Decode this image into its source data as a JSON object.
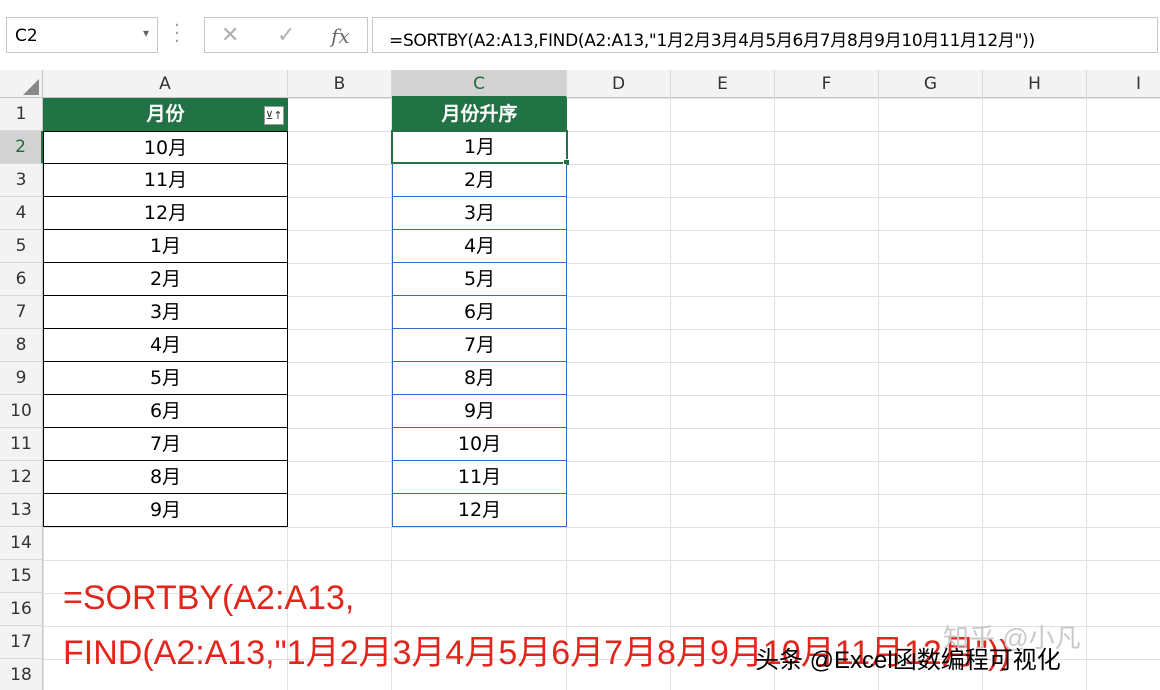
{
  "name_box": {
    "value": "C2",
    "dropdown_glyph": "▾"
  },
  "formula_buttons": {
    "cancel": "✕",
    "enter": "✓",
    "fx": "fx"
  },
  "formula_bar": {
    "value": "=SORTBY(A2:A13,FIND(A2:A13,\"1月2月3月4月5月6月7月8月9月10月11月12月\"))"
  },
  "columns": [
    "A",
    "B",
    "C",
    "D",
    "E",
    "F",
    "G",
    "H",
    "I"
  ],
  "rows": [
    "1",
    "2",
    "3",
    "4",
    "5",
    "6",
    "7",
    "8",
    "9",
    "10",
    "11",
    "12",
    "13",
    "14",
    "15",
    "16",
    "17",
    "18"
  ],
  "selected_column": "C",
  "selected_row": "2",
  "column_a": {
    "header": "月份",
    "filter_icon": "⊻↑",
    "values": [
      "10月",
      "11月",
      "12月",
      "1月",
      "2月",
      "3月",
      "4月",
      "5月",
      "6月",
      "7月",
      "8月",
      "9月"
    ]
  },
  "column_c": {
    "header": "月份升序",
    "values": [
      "1月",
      "2月",
      "3月",
      "4月",
      "5月",
      "6月",
      "7月",
      "8月",
      "9月",
      "10月",
      "11月",
      "12月"
    ]
  },
  "annotation": {
    "line1": "=SORTBY(A2:A13,",
    "line2": "FIND(A2:A13,\"1月2月3月4月5月6月7月8月9月10月11月12月\"))"
  },
  "watermark": {
    "text": "头条 @Excel函数编程可视化",
    "ghost": "知乎 @小凡"
  },
  "colors": {
    "header_green": "#217346",
    "annotation_red": "#e1261c",
    "selection_blue": "#2f6ec8"
  }
}
